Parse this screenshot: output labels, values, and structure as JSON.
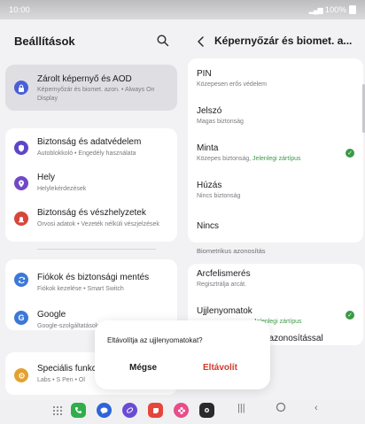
{
  "status": {
    "time": "10:00",
    "battery": "100%"
  },
  "left": {
    "title": "Beállítások",
    "items": [
      {
        "title": "Zárolt képernyő és AOD",
        "sub": "Képernyőzár és biomet. azon.  •  Always On Display",
        "icon": "lock-icon",
        "color": "#4a5fd6",
        "selected": true
      },
      {
        "title": "Biztonság és adatvédelem",
        "sub": "Autoblokkoló  •  Engedély használata",
        "icon": "shield-icon",
        "color": "#5e46c8"
      },
      {
        "title": "Hely",
        "sub": "Helylekérdezések",
        "icon": "location-pin-icon",
        "color": "#7248c9"
      },
      {
        "title": "Biztonság és vészhelyzetek",
        "sub": "Orvosi adatok  •  Vezeték nélküli vészjelzések",
        "icon": "emergency-icon",
        "color": "#d6473a"
      },
      {
        "title": "Fiókok és biztonsági mentés",
        "sub": "Fiókok kezelése  •  Smart Switch",
        "icon": "sync-icon",
        "color": "#3c78d8"
      },
      {
        "title": "Google",
        "sub": "Google-szolgáltatások",
        "icon": "google-icon",
        "color": "#3c78d8"
      },
      {
        "title": "Speciális funkc",
        "sub": "Labs  •  S Pen  •  Ol",
        "icon": "star-gear-icon",
        "color": "#e3a12e"
      }
    ]
  },
  "right": {
    "title": "Képernyőzár és biomet. a...",
    "lock_items": [
      {
        "title": "PIN",
        "sub": "Közepesen erős védelem"
      },
      {
        "title": "Jelszó",
        "sub": "Magas biztonság"
      },
      {
        "title": "Minta",
        "sub": "Közepes biztonság, ",
        "sub_current": "Jelenlegi zártípus",
        "checked": true
      },
      {
        "title": "Húzás",
        "sub": "Nincs biztonság"
      },
      {
        "title": "Nincs",
        "sub": ""
      }
    ],
    "section_label": "Biometrikus azonosítás",
    "bio_items": [
      {
        "title": "Arcfelismerés",
        "sub": "Regisztrálja arcát."
      },
      {
        "title": "Ujjlenyomatok",
        "sub": "",
        "sub_current": "Jelenlegi zártípus",
        "checked": true
      },
      {
        "title": ". azonosítással",
        "sub": ""
      }
    ]
  },
  "dialog": {
    "message": "Eltávolítja az ujjlenyomatokat?",
    "cancel": "Mégse",
    "remove": "Eltávolít"
  },
  "navbar": {
    "apps": [
      {
        "name": "apps-grid-icon",
        "color": "none"
      },
      {
        "name": "phone-app-icon",
        "color": "#2fae4b"
      },
      {
        "name": "messages-app-icon",
        "color": "#2e64d8"
      },
      {
        "name": "internet-app-icon",
        "color": "#6a4bd6"
      },
      {
        "name": "notes-app-icon",
        "color": "#e5463a"
      },
      {
        "name": "gallery-app-icon",
        "color": "#e84c8a"
      },
      {
        "name": "camera-app-icon",
        "color": "#2a2a2e"
      }
    ]
  }
}
